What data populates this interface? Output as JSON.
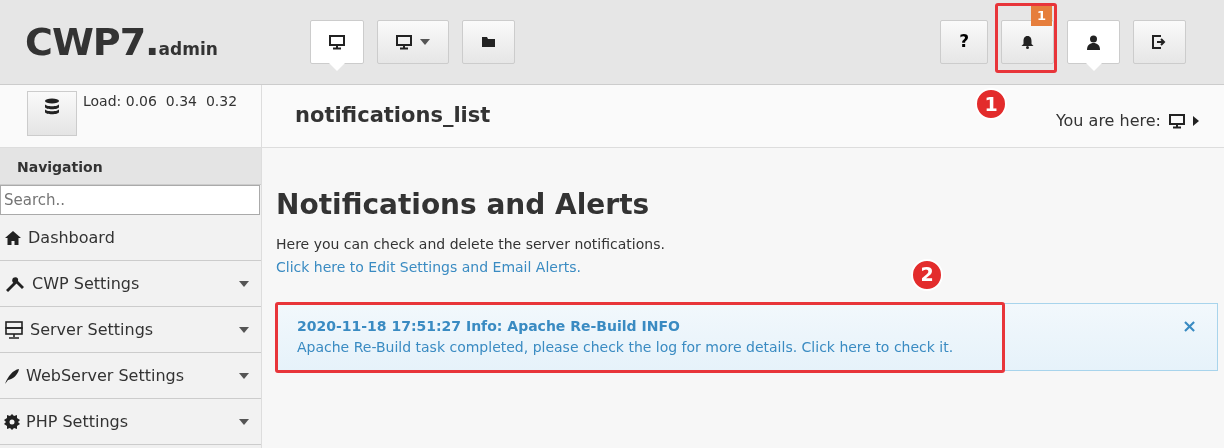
{
  "header": {
    "brand": "CWP7.",
    "brand_suffix": "admin",
    "left_buttons": [
      {
        "selected": true,
        "dropdown": false
      },
      {
        "selected": false,
        "dropdown": true
      },
      {
        "selected": false,
        "dropdown": false
      }
    ],
    "right_buttons": [
      {
        "text": "?",
        "selected": false
      },
      {
        "selected": false,
        "badge": "1",
        "annotation": "1"
      },
      {
        "selected": true
      },
      {
        "selected": false
      }
    ]
  },
  "subbar": {
    "load": "Load: 0.06  0.34  0.32",
    "page_title": "notifications_list",
    "breadcrumb": "You are here:"
  },
  "sidebar": {
    "heading": "Navigation",
    "search": {
      "placeholder": "Search.."
    },
    "items": [
      {
        "label": "Dashboard",
        "dropdown": false
      },
      {
        "label": "CWP Settings",
        "dropdown": true
      },
      {
        "label": "Server Settings",
        "dropdown": true
      },
      {
        "label": "WebServer Settings",
        "dropdown": true
      },
      {
        "label": "PHP Settings",
        "dropdown": true
      }
    ]
  },
  "main": {
    "heading": "Notifications and Alerts",
    "description": "Here you can check and delete the server notifications.",
    "settings_link": "Click here to Edit Settings and Email Alerts.",
    "notifications": [
      {
        "title": "2020-11-18 17:51:27 Info: Apache Re-Build INFO",
        "message": "Apache Re-Build task completed, please check the log for more details. Click here to check it.",
        "close": "×",
        "annotation": "2"
      }
    ]
  }
}
